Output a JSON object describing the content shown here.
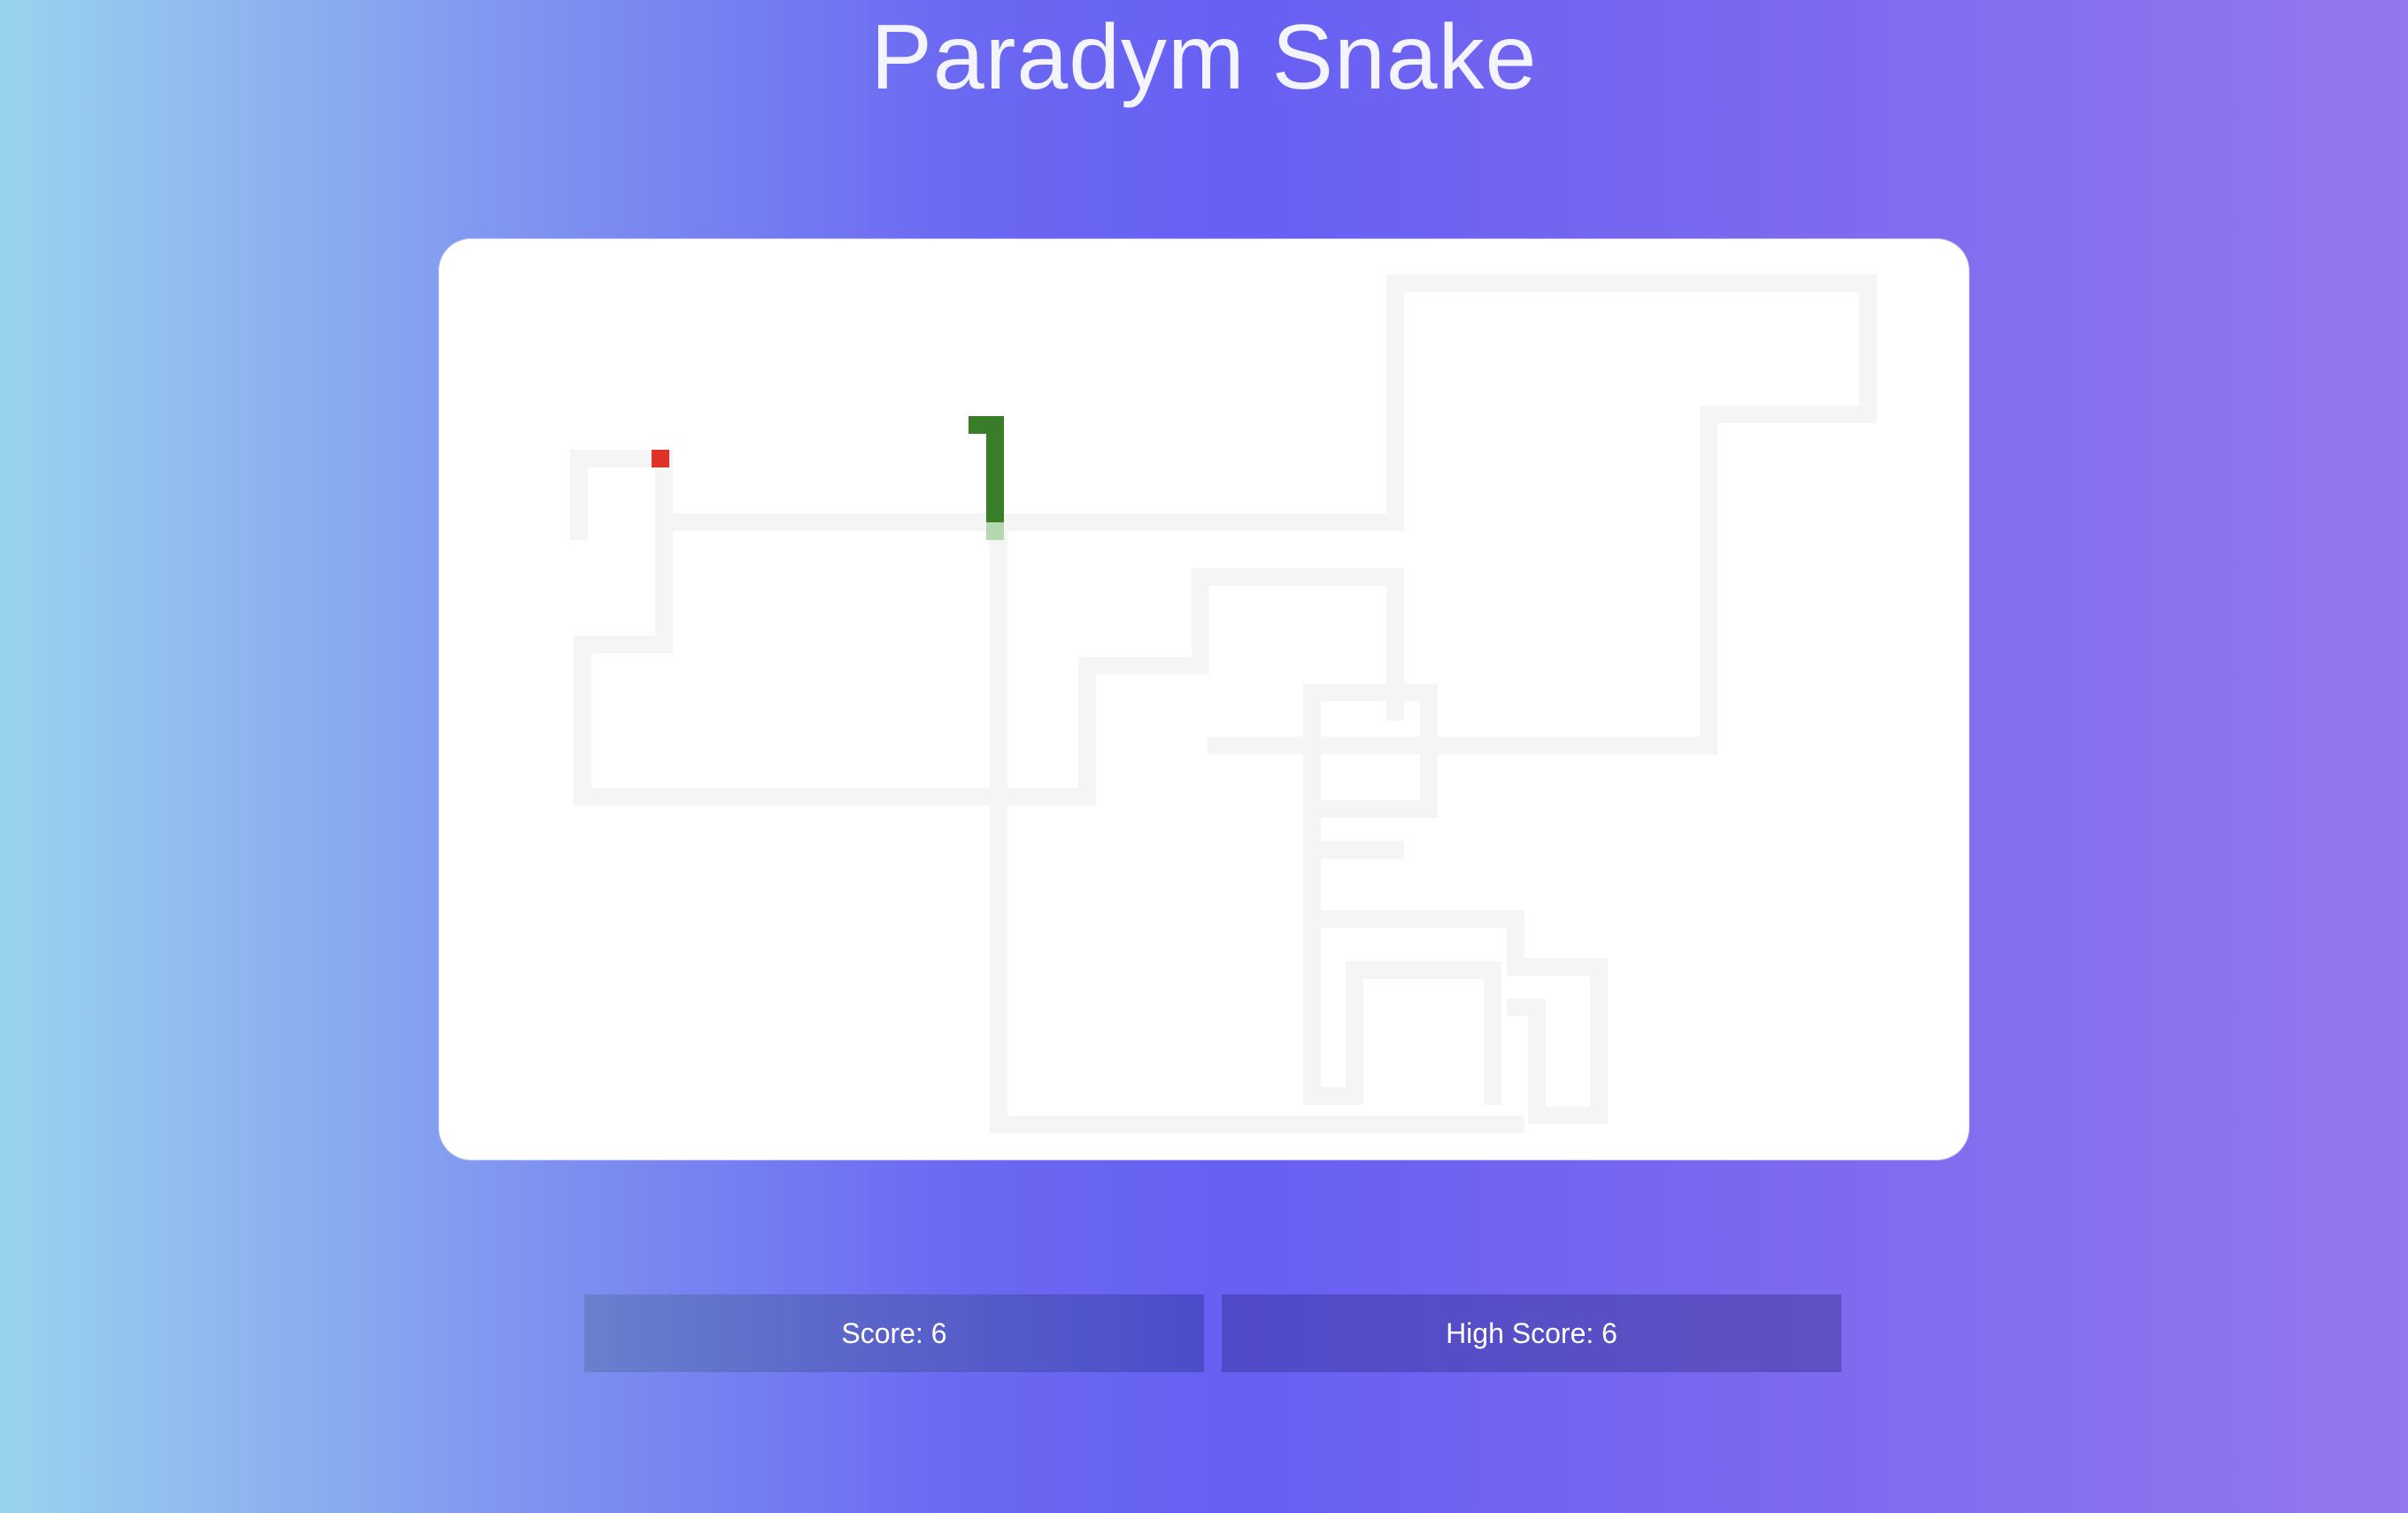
{
  "title": "Paradym Snake",
  "score": {
    "label": "Score: 6",
    "value": 6
  },
  "high_score": {
    "label": "High Score: 6",
    "value": 6
  },
  "game": {
    "colors": {
      "snake": "#3a7d28",
      "snake_tail_fading": "#b4d9ae",
      "food": "#e03126",
      "trail": "#f4f4f4",
      "board": "#ffffff"
    },
    "icons": {
      "food": "food-pellet-icon",
      "snake": "snake-icon"
    }
  }
}
